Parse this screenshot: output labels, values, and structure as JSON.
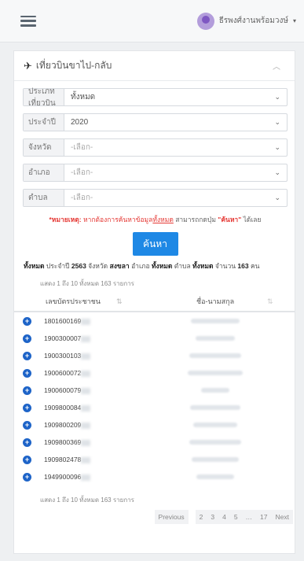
{
  "header": {
    "user_name": "ธีรพงศ์งานพร้อมวงษ์"
  },
  "card": {
    "title": "เที่ยวบินขาไป-กลับ"
  },
  "filters": [
    {
      "label": "ประเภทเที่ยวบิน",
      "value": "ทั้งหมด"
    },
    {
      "label": "ประจำปี",
      "value": "2020"
    },
    {
      "label": "จังหวัด",
      "value": "-เลือก-"
    },
    {
      "label": "อำเภอ",
      "value": "-เลือก-"
    },
    {
      "label": "ตำบล",
      "value": "-เลือก-"
    }
  ],
  "note": {
    "prefix": "*หมายเหตุ:",
    "text1": " หากต้องการค้นหาข้อมูล",
    "link": "ทั้งหมด",
    "text2": " สามารถกดปุ่ม ",
    "button_ref": "\"ค้นหา\"",
    "text3": " ได้เลย"
  },
  "search_button": "ค้นหา",
  "summary": {
    "all1": "ทั้งหมด",
    "year_lbl": " ประจำปี ",
    "year": "2563",
    "prov_lbl": " จังหวัด ",
    "prov": "สงขลา",
    "dist_lbl": " อำเภอ ",
    "dist": "ทั้งหมด",
    "sub_lbl": " ตำบล ",
    "sub": "ทั้งหมด",
    "count_lbl": " จำนวน ",
    "count": "163",
    "unit": " คน"
  },
  "table": {
    "showing_top": "แสดง 1 ถึง 10 ทั้งหมด 163 รายการ",
    "col_id": "เลขบัตรประชาชน",
    "col_name": "ชื่อ-นามสกุล",
    "sort_icon_1": "⇅",
    "sort_icon_2": "⇅",
    "rows": [
      {
        "id": "1801600169"
      },
      {
        "id": "1900300007"
      },
      {
        "id": "1900300103"
      },
      {
        "id": "1900600072"
      },
      {
        "id": "1900600079"
      },
      {
        "id": "1909800084"
      },
      {
        "id": "1909800209"
      },
      {
        "id": "1909800369"
      },
      {
        "id": "1909802478"
      },
      {
        "id": "1949900096"
      }
    ],
    "showing_bottom": "แสดง 1 ถึง 10 ทั้งหมด 163 รายการ"
  },
  "pagination": {
    "prev": "Previous",
    "p2": "2",
    "p3": "3",
    "p4": "4",
    "p5": "5",
    "ellipsis": "…",
    "last": "17",
    "next": "Next"
  }
}
